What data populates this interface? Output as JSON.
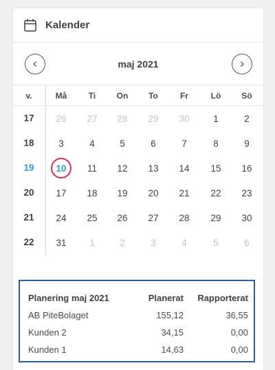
{
  "header": {
    "title": "Kalender",
    "icon": "calendar-icon"
  },
  "calendar": {
    "month_label": "maj 2021",
    "prev_icon": "chevron-left-icon",
    "next_icon": "chevron-right-icon",
    "week_header": "v.",
    "weekdays": [
      "Må",
      "Ti",
      "On",
      "To",
      "Fr",
      "Lö",
      "Sö"
    ],
    "current_week": "19",
    "selected_day": "10",
    "weeks": [
      {
        "week": "17",
        "days": [
          {
            "d": "26",
            "muted": true
          },
          {
            "d": "27",
            "muted": true
          },
          {
            "d": "28",
            "muted": true
          },
          {
            "d": "29",
            "muted": true
          },
          {
            "d": "30",
            "muted": true
          },
          {
            "d": "1",
            "muted": false
          },
          {
            "d": "2",
            "muted": false
          }
        ]
      },
      {
        "week": "18",
        "days": [
          {
            "d": "3",
            "muted": false
          },
          {
            "d": "4",
            "muted": false
          },
          {
            "d": "5",
            "muted": false
          },
          {
            "d": "6",
            "muted": false
          },
          {
            "d": "7",
            "muted": false
          },
          {
            "d": "8",
            "muted": false
          },
          {
            "d": "9",
            "muted": false
          }
        ]
      },
      {
        "week": "19",
        "days": [
          {
            "d": "10",
            "muted": false
          },
          {
            "d": "11",
            "muted": false
          },
          {
            "d": "12",
            "muted": false
          },
          {
            "d": "13",
            "muted": false
          },
          {
            "d": "14",
            "muted": false
          },
          {
            "d": "15",
            "muted": false
          },
          {
            "d": "16",
            "muted": false
          }
        ]
      },
      {
        "week": "20",
        "days": [
          {
            "d": "17",
            "muted": false
          },
          {
            "d": "18",
            "muted": false
          },
          {
            "d": "19",
            "muted": false
          },
          {
            "d": "20",
            "muted": false
          },
          {
            "d": "21",
            "muted": false
          },
          {
            "d": "22",
            "muted": false
          },
          {
            "d": "23",
            "muted": false
          }
        ]
      },
      {
        "week": "21",
        "days": [
          {
            "d": "24",
            "muted": false
          },
          {
            "d": "25",
            "muted": false
          },
          {
            "d": "26",
            "muted": false
          },
          {
            "d": "27",
            "muted": false
          },
          {
            "d": "28",
            "muted": false
          },
          {
            "d": "29",
            "muted": false
          },
          {
            "d": "30",
            "muted": false
          }
        ]
      },
      {
        "week": "22",
        "days": [
          {
            "d": "31",
            "muted": false
          },
          {
            "d": "1",
            "muted": true
          },
          {
            "d": "2",
            "muted": true
          },
          {
            "d": "3",
            "muted": true
          },
          {
            "d": "4",
            "muted": true
          },
          {
            "d": "5",
            "muted": true
          },
          {
            "d": "6",
            "muted": true
          }
        ]
      }
    ]
  },
  "planning": {
    "columns": [
      "Planering maj 2021",
      "Planerat",
      "Rapporterat"
    ],
    "rows": [
      {
        "name": "AB PiteBolaget",
        "planned": "155,12",
        "reported": "36,55"
      },
      {
        "name": "Kunden 2",
        "planned": "34,15",
        "reported": "0,00"
      },
      {
        "name": "Kunden 1",
        "planned": "14,63",
        "reported": "0,00"
      }
    ]
  },
  "colors": {
    "accent": "#2a9fd6",
    "today_ring": "#d62e5e",
    "summary_border": "#2a5d9f",
    "muted_text": "#c4c4c8"
  }
}
